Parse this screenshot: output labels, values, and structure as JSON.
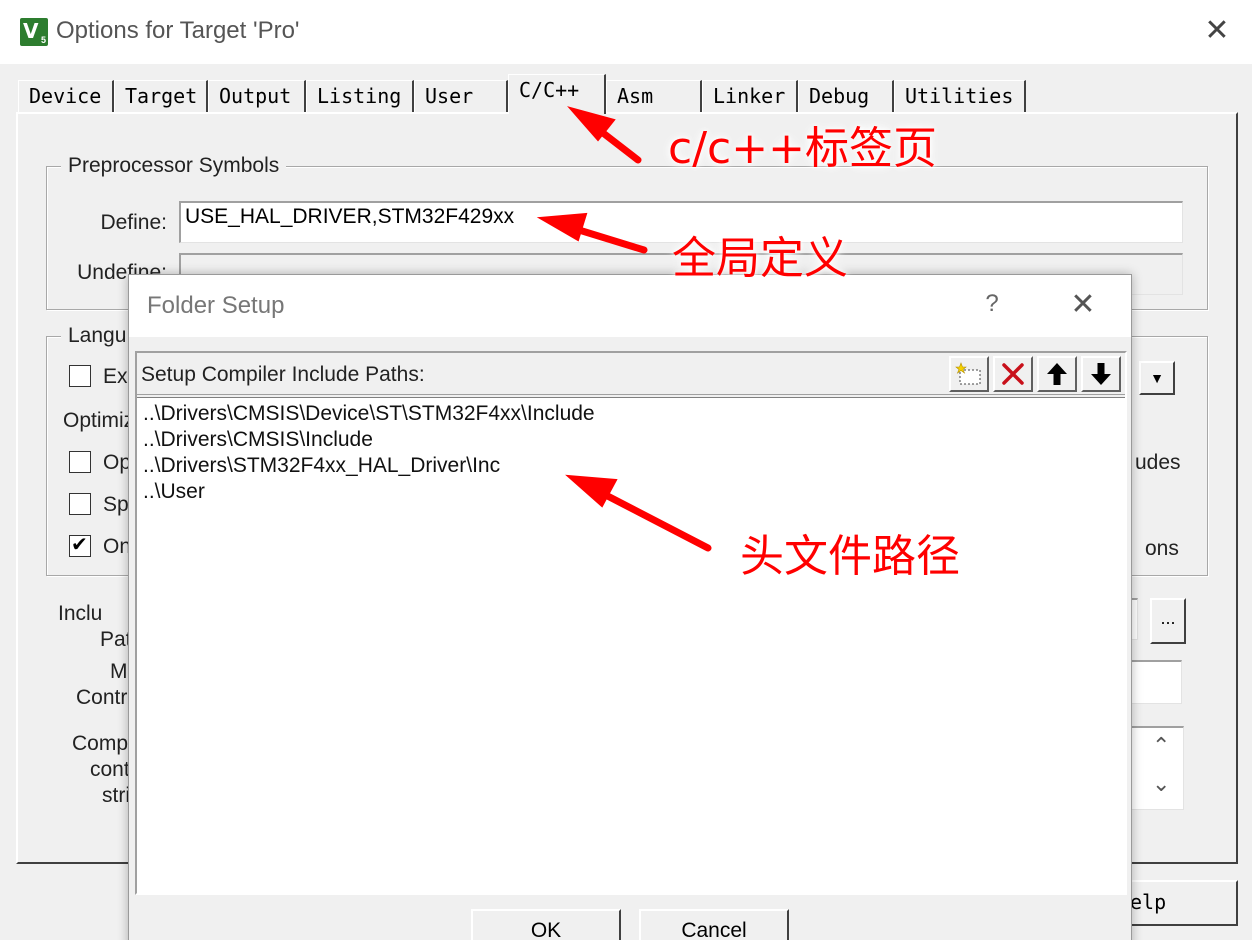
{
  "window": {
    "title": "Options for Target 'Pro'",
    "icon_text": "V",
    "icon_sub": "5"
  },
  "tabs": [
    {
      "label": "Device"
    },
    {
      "label": "Target"
    },
    {
      "label": "Output"
    },
    {
      "label": "Listing"
    },
    {
      "label": "User"
    },
    {
      "label": "C/C++",
      "active": true
    },
    {
      "label": "Asm"
    },
    {
      "label": "Linker"
    },
    {
      "label": "Debug"
    },
    {
      "label": "Utilities"
    }
  ],
  "preprocessor": {
    "title": "Preprocessor Symbols",
    "define_label": "Define:",
    "define_value": "USE_HAL_DRIVER,STM32F429xx",
    "undefine_label": "Undefine:",
    "undefine_value": ""
  },
  "language": {
    "title": "Langu",
    "exe_label": "Exe",
    "optimiz_label": "Optimiz",
    "opt_label": "Opt",
    "spl_label": "Spl",
    "on_label": "On",
    "right_udes": "udes",
    "right_ons": "ons"
  },
  "include": {
    "label_1": "Inclu",
    "label_2": "Pat",
    "mi_label": "Mi",
    "contro_label": "Contro",
    "compi_label": "Compi",
    "cont_label": "cont",
    "stri_label": "stri",
    "browse_label": "..."
  },
  "main_buttons": {
    "help_partial": "elp"
  },
  "folder_setup": {
    "title": "Folder Setup",
    "help_label": "?",
    "header_label": "Setup Compiler Include Paths:",
    "paths": [
      "..\\Drivers\\CMSIS\\Device\\ST\\STM32F4xx\\Include",
      "..\\Drivers\\CMSIS\\Include",
      "..\\Drivers\\STM32F4xx_HAL_Driver\\Inc",
      "..\\User"
    ],
    "ok_label": "OK",
    "cancel_label": "Cancel",
    "toolbar_icons": [
      "new-folder-icon",
      "delete-icon",
      "move-up-icon",
      "move-down-icon"
    ]
  },
  "annotations": {
    "tab_note": "c/c++标签页",
    "define_note": "全局定义",
    "paths_note": "头文件路径",
    "color": "#ff0000"
  }
}
